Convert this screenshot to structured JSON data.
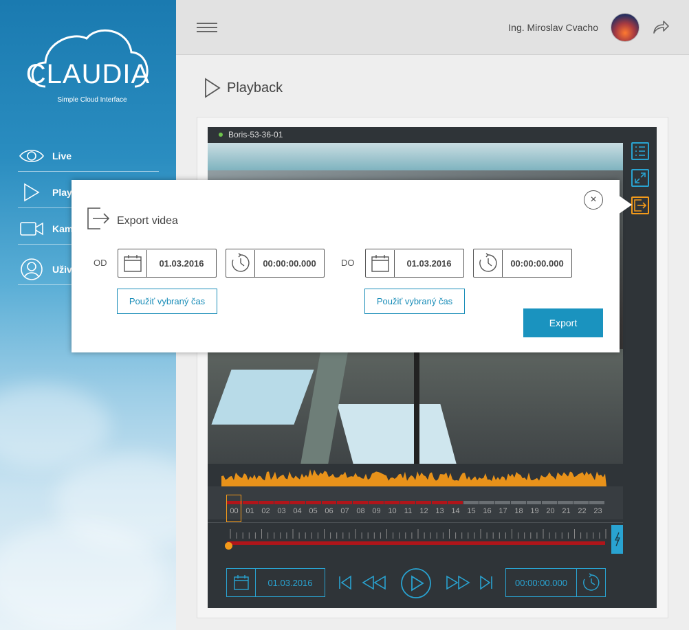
{
  "app": {
    "logo_text": "CLAUDIA",
    "logo_subtitle": "Simple Cloud Interface"
  },
  "sidebar": {
    "items": [
      {
        "label": "Live",
        "icon": "eye-icon"
      },
      {
        "label": "Play",
        "icon": "play-icon"
      },
      {
        "label": "Kam",
        "icon": "camera-icon"
      },
      {
        "label": "Uživ",
        "icon": "user-icon"
      }
    ]
  },
  "header": {
    "user_name": "Ing. Miroslav Cvacho"
  },
  "page": {
    "title": "Playback"
  },
  "player": {
    "camera_name": "Boris-53-36-01",
    "hours": [
      "00",
      "01",
      "02",
      "03",
      "04",
      "05",
      "06",
      "07",
      "08",
      "09",
      "10",
      "11",
      "12",
      "13",
      "14",
      "15",
      "16",
      "17",
      "18",
      "19",
      "20",
      "21",
      "22",
      "23"
    ],
    "recorded_hours": 15,
    "selected_hour": "00",
    "date": "01.03.2016",
    "time": "00:00:00.000",
    "scrub_position": 0
  },
  "export_popup": {
    "title": "Export videa",
    "from_label": "OD",
    "to_label": "DO",
    "from_date": "01.03.2016",
    "from_time": "00:00:00.000",
    "to_date": "01.03.2016",
    "to_time": "00:00:00.000",
    "use_selected_time_label": "Použiť vybraný čas",
    "export_label": "Export",
    "close_glyph": "×"
  },
  "colors": {
    "accent": "#29a3d1",
    "active": "#f39a1a",
    "timeline_record": "#b0151a"
  }
}
